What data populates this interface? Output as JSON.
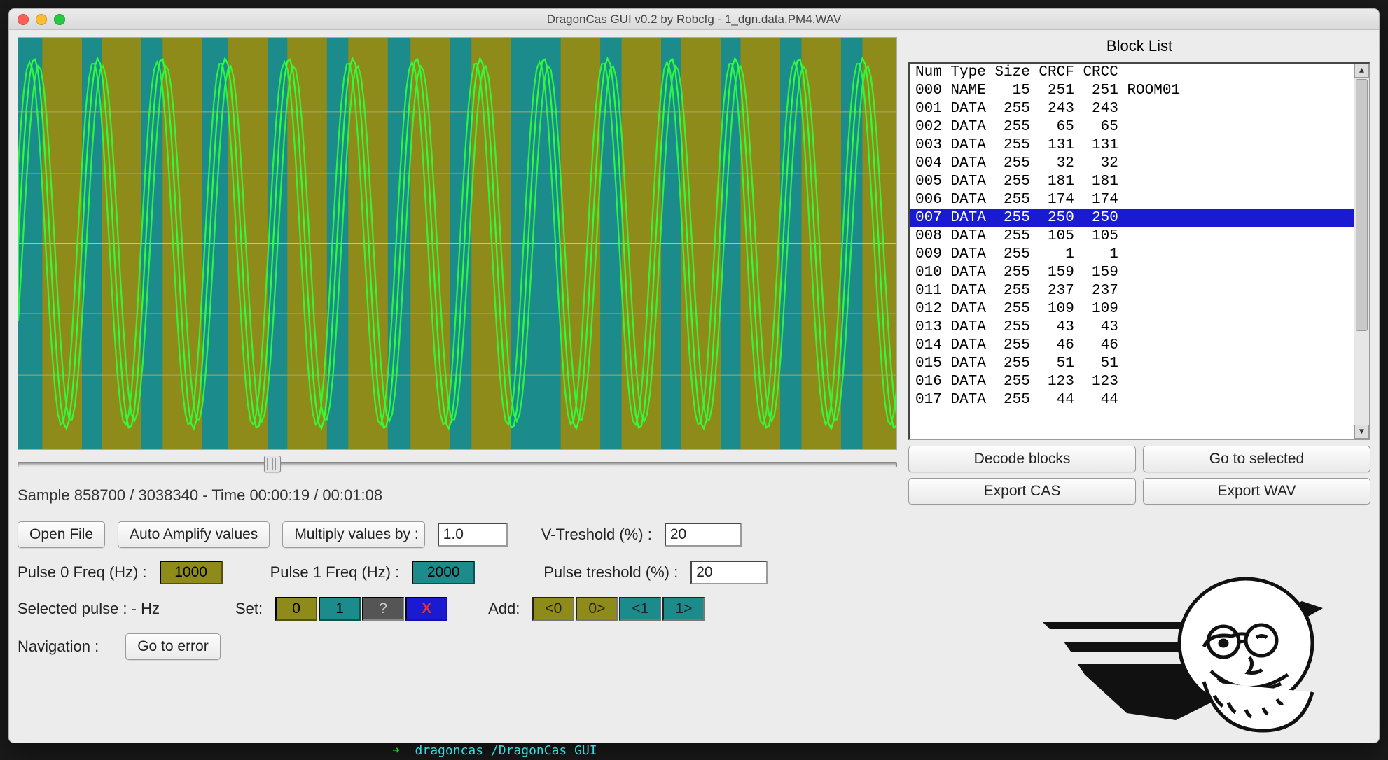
{
  "window": {
    "title": "DragonCas GUI v0.2 by Robcfg - 1_dgn.data.PM4.WAV"
  },
  "status": {
    "text": "Sample 858700 / 3038340 - Time 00:00:19 / 00:01:08"
  },
  "slider": {
    "position_pct": 28
  },
  "buttons": {
    "open_file": "Open File",
    "auto_amplify": "Auto Amplify values",
    "multiply_label": "Multiply values by :",
    "go_to_error": "Go to error",
    "decode_blocks": "Decode blocks",
    "go_to_selected": "Go to selected",
    "export_cas": "Export CAS",
    "export_wav": "Export WAV"
  },
  "inputs": {
    "multiply_value": "1.0",
    "vthreshold_label": "V-Treshold (%) :",
    "vthreshold_value": "20",
    "pulse0_label": "Pulse 0 Freq (Hz) :",
    "pulse0_value": "1000",
    "pulse1_label": "Pulse 1 Freq (Hz) :",
    "pulse1_value": "2000",
    "pulset_label": "Pulse treshold (%) :",
    "pulset_value": "20"
  },
  "selected_pulse": {
    "label": "Selected pulse : - Hz",
    "set_label": "Set:",
    "add_label": "Add:",
    "set_buttons": [
      "0",
      "1",
      "?",
      "X"
    ],
    "add_buttons": [
      "<0",
      "0>",
      "<1",
      "1>"
    ]
  },
  "navigation": {
    "label": "Navigation :"
  },
  "blocklist": {
    "title": "Block List",
    "header": [
      "Num",
      "Type",
      "Size",
      "CRCF",
      "CRCC",
      ""
    ],
    "selected_index": 7,
    "rows": [
      {
        "num": "000",
        "type": "NAME",
        "size": "15",
        "crcf": "251",
        "crcc": "251",
        "extra": "ROOM01"
      },
      {
        "num": "001",
        "type": "DATA",
        "size": "255",
        "crcf": "243",
        "crcc": "243",
        "extra": ""
      },
      {
        "num": "002",
        "type": "DATA",
        "size": "255",
        "crcf": "65",
        "crcc": "65",
        "extra": ""
      },
      {
        "num": "003",
        "type": "DATA",
        "size": "255",
        "crcf": "131",
        "crcc": "131",
        "extra": ""
      },
      {
        "num": "004",
        "type": "DATA",
        "size": "255",
        "crcf": "32",
        "crcc": "32",
        "extra": ""
      },
      {
        "num": "005",
        "type": "DATA",
        "size": "255",
        "crcf": "181",
        "crcc": "181",
        "extra": ""
      },
      {
        "num": "006",
        "type": "DATA",
        "size": "255",
        "crcf": "174",
        "crcc": "174",
        "extra": ""
      },
      {
        "num": "007",
        "type": "DATA",
        "size": "255",
        "crcf": "250",
        "crcc": "250",
        "extra": ""
      },
      {
        "num": "008",
        "type": "DATA",
        "size": "255",
        "crcf": "105",
        "crcc": "105",
        "extra": ""
      },
      {
        "num": "009",
        "type": "DATA",
        "size": "255",
        "crcf": "1",
        "crcc": "1",
        "extra": ""
      },
      {
        "num": "010",
        "type": "DATA",
        "size": "255",
        "crcf": "159",
        "crcc": "159",
        "extra": ""
      },
      {
        "num": "011",
        "type": "DATA",
        "size": "255",
        "crcf": "237",
        "crcc": "237",
        "extra": ""
      },
      {
        "num": "012",
        "type": "DATA",
        "size": "255",
        "crcf": "109",
        "crcc": "109",
        "extra": ""
      },
      {
        "num": "013",
        "type": "DATA",
        "size": "255",
        "crcf": "43",
        "crcc": "43",
        "extra": ""
      },
      {
        "num": "014",
        "type": "DATA",
        "size": "255",
        "crcf": "46",
        "crcc": "46",
        "extra": ""
      },
      {
        "num": "015",
        "type": "DATA",
        "size": "255",
        "crcf": "51",
        "crcc": "51",
        "extra": ""
      },
      {
        "num": "016",
        "type": "DATA",
        "size": "255",
        "crcf": "123",
        "crcc": "123",
        "extra": ""
      },
      {
        "num": "017",
        "type": "DATA",
        "size": "255",
        "crcf": "44",
        "crcc": "44",
        "extra": ""
      }
    ]
  },
  "footer": {
    "path_arrow": "➜",
    "path": "dragoncas  /DragonCas GUI"
  },
  "colors": {
    "pulse0": "#8f8b1b",
    "pulse1": "#1b8b8b",
    "wave": "#2eff3a",
    "selection": "#1a1ad0"
  }
}
